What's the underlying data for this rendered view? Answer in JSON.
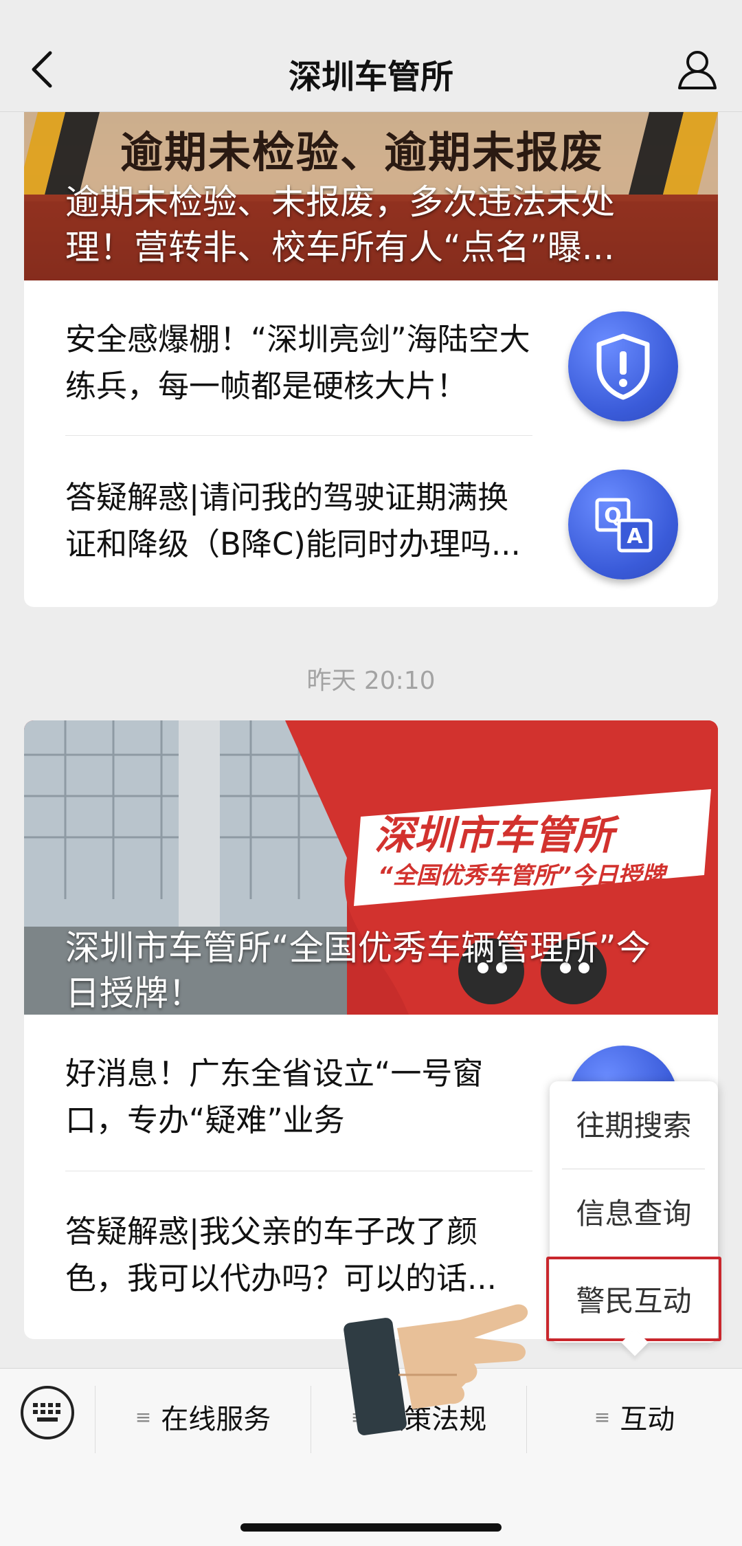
{
  "header": {
    "title": "深圳车管所"
  },
  "articles_group1": {
    "cover_title": "逾期未检验、未报废，多次违法未处理！营转非、校车所有人“点名”曝...",
    "cover_banner_text": "逾期未检验、逾期未报废",
    "items": [
      {
        "text": "安全感爆棚！“深圳亮剑”海陆空大练兵，每一帧都是硬核大片！",
        "icon": "shield-alert-icon"
      },
      {
        "text": "答疑解惑|请问我的驾驶证期满换证和降级（B降C)能同时办理吗...",
        "icon": "qa-icon"
      }
    ]
  },
  "timestamp": "昨天 20:10",
  "articles_group2": {
    "cover_title": "深圳市车管所“全国优秀车辆管理所”今日授牌！",
    "cover_banner_line1": "深圳市车管所",
    "cover_banner_line2": "“全国优秀车管所”今日授牌",
    "items": [
      {
        "text": "好消息！广东全省设立“一号窗口，专办“疑难”业务"
      },
      {
        "text": "答疑解惑|我父亲的车子改了颜色，我可以代办吗？可以的话..."
      }
    ]
  },
  "popup_menu": {
    "items": [
      "往期搜索",
      "信息查询",
      "警民互动"
    ],
    "highlighted": "警民互动"
  },
  "bottom_bar": {
    "tabs": [
      "在线服务",
      "政策法规",
      "互动"
    ]
  },
  "colors": {
    "accent_red": "#c9262c",
    "icon_blue": "#3a5bd9"
  }
}
